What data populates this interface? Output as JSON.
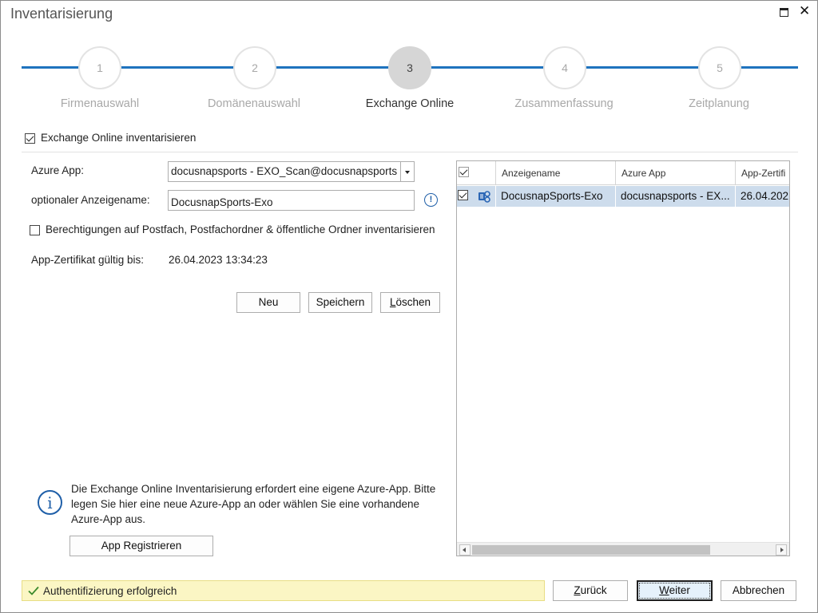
{
  "window": {
    "title": "Inventarisierung"
  },
  "steps": [
    {
      "number": "1",
      "label": "Firmenauswahl",
      "active": false
    },
    {
      "number": "2",
      "label": "Domänenauswahl",
      "active": false
    },
    {
      "number": "3",
      "label": "Exchange Online",
      "active": true
    },
    {
      "number": "4",
      "label": "Zusammenfassung",
      "active": false
    },
    {
      "number": "5",
      "label": "Zeitplanung",
      "active": false
    }
  ],
  "form": {
    "inventory_checkbox_label": "Exchange Online inventarisieren",
    "inventory_checked": true,
    "azure_app_label": "Azure App:",
    "azure_app_value": "docusnapsports - EXO_Scan@docusnapsports",
    "display_name_label": "optionaler Anzeigename:",
    "display_name_value": "DocusnapSports-Exo",
    "permissions_checkbox_label": "Berechtigungen auf Postfach, Postfachordner & öffentliche Ordner inventarisieren",
    "permissions_checked": false,
    "cert_label": "App-Zertifikat gültig bis:",
    "cert_value": "26.04.2023 13:34:23",
    "buttons": {
      "new": "Neu",
      "save": "Speichern",
      "delete_first": "L",
      "delete_rest": "öschen"
    }
  },
  "grid": {
    "columns": [
      "Anzeigename",
      "Azure App",
      "App-Zertifi"
    ],
    "rows": [
      {
        "checked": true,
        "icon": "exchange-icon",
        "name": "DocusnapSports-Exo",
        "azure_app": "docusnapsports - EX...",
        "cert": "26.04.202"
      }
    ]
  },
  "info": {
    "text": "Die Exchange Online Inventarisierung erfordert eine eigene Azure-App. Bitte legen Sie hier eine neue Azure-App an oder wählen Sie eine vorhandene Azure-App aus.",
    "register_button": "App Registrieren"
  },
  "status": {
    "text": "Authentifizierung erfolgreich",
    "color": "#fbf6c4"
  },
  "footer": {
    "back_first": "Z",
    "back_rest": "urück",
    "next_first": "W",
    "next_rest": "eiter",
    "cancel": "Abbrechen"
  },
  "colors": {
    "accent": "#1e73be",
    "selection": "#cddcec",
    "info_blue": "#1f5fa8"
  }
}
